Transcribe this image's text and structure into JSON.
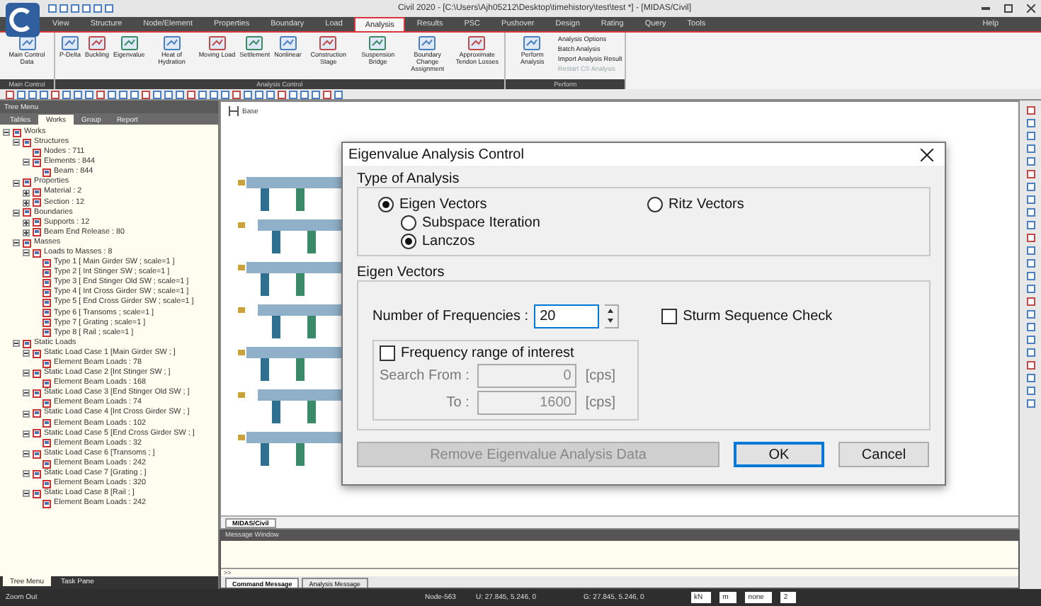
{
  "window": {
    "title": "Civil 2020 - [C:\\Users\\Ajh05212\\Desktop\\timehistory\\test\\test *] - [MIDAS/Civil]"
  },
  "menu_tabs": [
    {
      "label": "View",
      "selected": false
    },
    {
      "label": "Structure",
      "selected": false
    },
    {
      "label": "Node/Element",
      "selected": false
    },
    {
      "label": "Properties",
      "selected": false
    },
    {
      "label": "Boundary",
      "selected": false
    },
    {
      "label": "Load",
      "selected": false
    },
    {
      "label": "Analysis",
      "selected": true
    },
    {
      "label": "Results",
      "selected": false
    },
    {
      "label": "PSC",
      "selected": false
    },
    {
      "label": "Pushover",
      "selected": false
    },
    {
      "label": "Design",
      "selected": false
    },
    {
      "label": "Rating",
      "selected": false
    },
    {
      "label": "Query",
      "selected": false
    },
    {
      "label": "Tools",
      "selected": false
    }
  ],
  "help": "Help",
  "ribbon_groups": [
    {
      "caption": "Main Control",
      "buttons": [
        "Main Control Data"
      ]
    },
    {
      "caption": "Analysis Control",
      "buttons": [
        "P-Delta",
        "Buckling",
        "Eigenvalue",
        "Heat of Hydration",
        "Moving Load",
        "Settlement",
        "Nonlinear",
        "Construction Stage",
        "Suspension Bridge",
        "Boundary Change Assignment",
        "Approximate Tendon Losses"
      ]
    },
    {
      "caption": "Perform",
      "buttons": [
        "Perform Analysis"
      ],
      "small_buttons": [
        {
          "label": "Analysis Options",
          "disabled": false
        },
        {
          "label": "Batch Analysis",
          "disabled": false
        },
        {
          "label": "Import Analysis Result",
          "disabled": false
        },
        {
          "label": "Restart CS Analysis",
          "disabled": true
        }
      ]
    }
  ],
  "tree_panel": {
    "title": "Tree Menu",
    "tabs": [
      {
        "label": "Tables",
        "selected": false
      },
      {
        "label": "Works",
        "selected": true
      },
      {
        "label": "Group",
        "selected": false
      },
      {
        "label": "Report",
        "selected": false
      }
    ],
    "tree": [
      {
        "label": "Works",
        "expanded": true,
        "children": [
          {
            "label": "Structures",
            "expanded": true,
            "children": [
              {
                "label": "Nodes : 711"
              },
              {
                "label": "Elements : 844",
                "expanded": true,
                "children": [
                  {
                    "label": "Beam : 844"
                  }
                ]
              }
            ]
          },
          {
            "label": "Properties",
            "expanded": true,
            "children": [
              {
                "label": "Material : 2",
                "expanded": false
              },
              {
                "label": "Section : 12",
                "expanded": false
              }
            ]
          },
          {
            "label": "Boundaries",
            "expanded": true,
            "children": [
              {
                "label": "Supports : 12",
                "expanded": false
              },
              {
                "label": "Beam End Release : 80",
                "expanded": false
              }
            ]
          },
          {
            "label": "Masses",
            "expanded": true,
            "children": [
              {
                "label": "Loads to Masses : 8",
                "expanded": true,
                "children": [
                  {
                    "label": "Type 1 [ Main Girder SW ; scale=1 ]"
                  },
                  {
                    "label": "Type 2 [ Int Stinger SW ; scale=1 ]"
                  },
                  {
                    "label": "Type 3 [ End Stinger Old SW ; scale=1 ]"
                  },
                  {
                    "label": "Type 4 [ Int Cross Girder SW ; scale=1 ]"
                  },
                  {
                    "label": "Type 5 [ End Cross Girder SW ; scale=1 ]"
                  },
                  {
                    "label": "Type 6 [ Transoms ; scale=1 ]"
                  },
                  {
                    "label": "Type 7 [ Grating ; scale=1 ]"
                  },
                  {
                    "label": "Type 8 [ Rail ; scale=1 ]"
                  }
                ]
              }
            ]
          },
          {
            "label": "Static Loads",
            "expanded": true,
            "children": [
              {
                "label": "Static Load Case 1 [Main Girder SW ; ]",
                "expanded": true,
                "children": [
                  {
                    "label": "Element Beam Loads : 78"
                  }
                ]
              },
              {
                "label": "Static Load Case 2 [Int Stinger SW ; ]",
                "expanded": true,
                "children": [
                  {
                    "label": "Element Beam Loads : 168"
                  }
                ]
              },
              {
                "label": "Static Load Case 3 [End Stinger Old SW ; ]",
                "expanded": true,
                "children": [
                  {
                    "label": "Element Beam Loads : 74"
                  }
                ]
              },
              {
                "label": "Static Load Case 4 [Int Cross Girder SW ; ]",
                "expanded": true,
                "children": [
                  {
                    "label": "Element Beam Loads : 102"
                  }
                ]
              },
              {
                "label": "Static Load Case 5 [End Cross Girder SW ; ]",
                "expanded": true,
                "children": [
                  {
                    "label": "Element Beam Loads : 32"
                  }
                ]
              },
              {
                "label": "Static Load Case 6 [Transoms ; ]",
                "expanded": true,
                "children": [
                  {
                    "label": "Element Beam Loads : 242"
                  }
                ]
              },
              {
                "label": "Static Load Case 7 [Grating ; ]",
                "expanded": true,
                "children": [
                  {
                    "label": "Element Beam Loads : 320"
                  }
                ]
              },
              {
                "label": "Static Load Case 8 [Rail ; ]",
                "expanded": true,
                "children": [
                  {
                    "label": "Element Beam Loads : 242"
                  }
                ]
              }
            ]
          }
        ]
      }
    ],
    "bottom_tabs": [
      {
        "label": "Tree Menu",
        "selected": true
      },
      {
        "label": "Task Pane",
        "selected": false
      }
    ]
  },
  "viewport": {
    "label": "Base",
    "tab": "MIDAS/Civil"
  },
  "message_window": {
    "title": "Message Window",
    "prompt": ">>",
    "tabs": [
      {
        "label": "Command Message",
        "selected": true
      },
      {
        "label": "Analysis Message",
        "selected": false
      }
    ]
  },
  "status_bar": {
    "hint": "Zoom Out",
    "node": "Node-563",
    "u": "U: 27.845, 5.246, 0",
    "g": "G: 27.845, 5.246, 0",
    "force_unit": "kN",
    "length_unit": "m",
    "filter": "none",
    "page": "2"
  },
  "dialog": {
    "title": "Eigenvalue Analysis Control",
    "type_group": "Type of Analysis",
    "types": [
      {
        "label": "Eigen Vectors",
        "selected": true
      },
      {
        "label": "Ritz Vectors",
        "selected": false
      }
    ],
    "methods": [
      {
        "label": "Subspace Iteration",
        "selected": false
      },
      {
        "label": "Lanczos",
        "selected": true
      }
    ],
    "eigen_group": "Eigen Vectors",
    "frequencies_label": "Number of Frequencies :",
    "frequencies": "20",
    "sturm": {
      "label": "Sturm Sequence Check",
      "checked": false
    },
    "range": {
      "label": "Frequency range of interest",
      "checked": false,
      "from_label": "Search From :",
      "from": "0",
      "to_label": "To :",
      "to": "1600",
      "from_unit": "[cps]",
      "to_unit": "[cps]"
    },
    "buttons": [
      {
        "label": "Remove Eigenvalue Analysis Data",
        "disabled": true,
        "default": false
      },
      {
        "label": "OK",
        "disabled": false,
        "default": true
      },
      {
        "label": "Cancel",
        "disabled": false,
        "default": false
      }
    ]
  }
}
